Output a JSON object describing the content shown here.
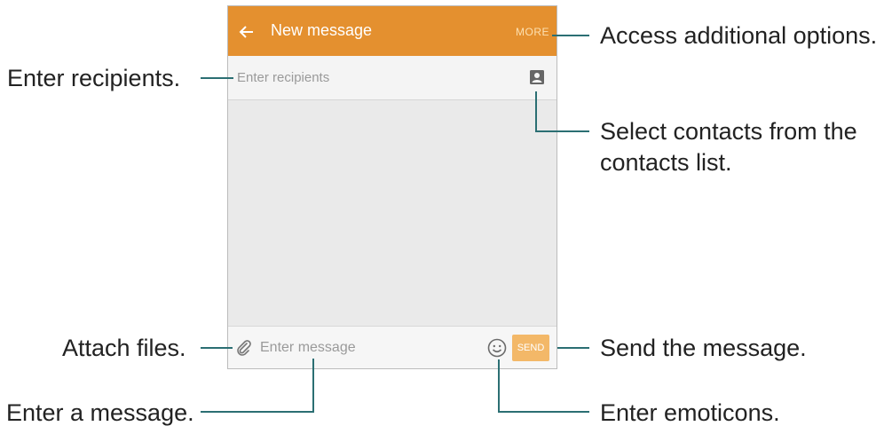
{
  "screen": {
    "app_bar": {
      "title": "New message",
      "back_icon": "arrow-left-icon",
      "more_label": "MORE",
      "color": "#e4902f"
    },
    "recipients": {
      "placeholder": "Enter recipients",
      "contact_icon": "contact-card-icon"
    },
    "compose": {
      "attach_icon": "paperclip-icon",
      "placeholder": "Enter message",
      "emoticon_icon": "smiley-icon",
      "send_label": "SEND",
      "send_color": "#f3b868"
    }
  },
  "annotations": {
    "more_options": "Access additional options.",
    "enter_recipients": "Enter recipients.",
    "select_contacts_line1": "Select contacts from the",
    "select_contacts_line2": "contacts list.",
    "attach_files": "Attach files.",
    "send_message": "Send the message.",
    "enter_message": "Enter a message.",
    "enter_emoticons": "Enter emoticons."
  }
}
